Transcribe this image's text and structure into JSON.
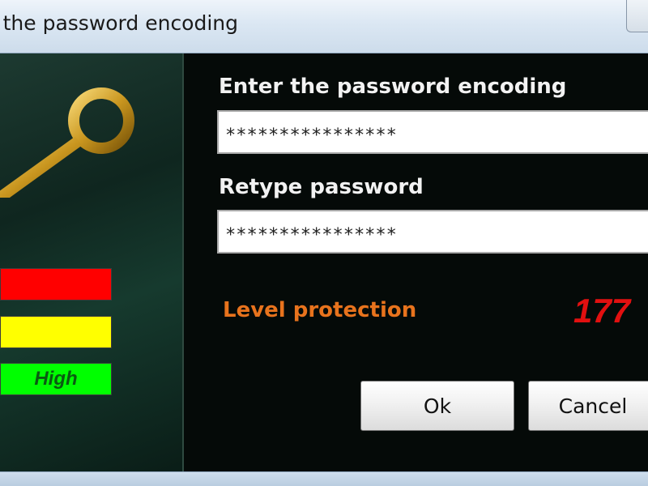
{
  "window": {
    "title": "er the password encoding"
  },
  "form": {
    "password_label": "Enter the password encoding",
    "password_value": "****************",
    "retype_label": "Retype password",
    "retype_value": "****************",
    "level_label": "Level protection",
    "level_value": "177"
  },
  "strength_meter": {
    "high_label": "High",
    "colors": {
      "low": "#ff0000",
      "medium": "#ffff00",
      "high": "#00ff00"
    }
  },
  "buttons": {
    "ok_label": "Ok",
    "cancel_label": "Cancel"
  },
  "icons": {
    "key": "key-icon"
  },
  "colors": {
    "level_label": "#e8731d",
    "level_value": "#e21010",
    "background": "#050a08"
  }
}
